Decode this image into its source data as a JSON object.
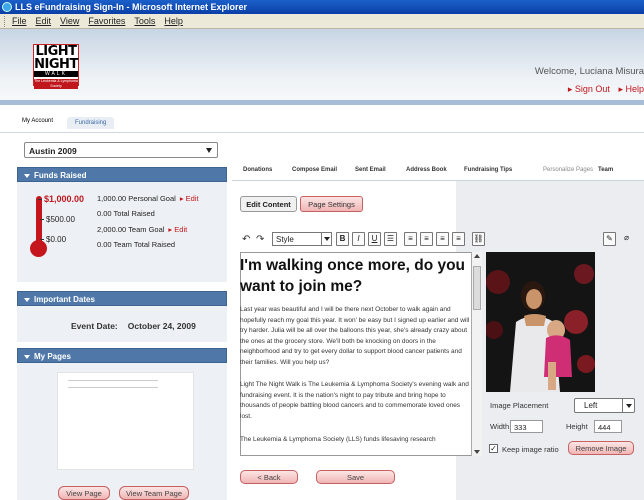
{
  "window": {
    "title": "LLS eFundraising Sign-In - Microsoft Internet Explorer"
  },
  "menu": {
    "items": [
      "File",
      "Edit",
      "View",
      "Favorites",
      "Tools",
      "Help"
    ]
  },
  "header": {
    "logo_top": "LIGHT",
    "logo_night": "NIGHT",
    "logo_walk": "WALK",
    "logo_society": "The Leukemia & Lymphoma Society",
    "welcome": "Welcome, Luciana Misura",
    "sign_out": "Sign Out",
    "help": "Help",
    "link_color": "#c0171d"
  },
  "account_nav": {
    "my_account": "My Account",
    "fundraising": "Fundraising"
  },
  "sidebar": {
    "campaign": "Austin 2009",
    "funds": {
      "title": "Funds Raised",
      "top_label": "$1,000.00",
      "mid_label": "$500.00",
      "low_label": "$0.00",
      "progress": 0.0,
      "rows": [
        {
          "text": "1,000.00 Personal Goal",
          "edit": "Edit"
        },
        {
          "text": "0.00 Total Raised",
          "edit": ""
        },
        {
          "text": "2,000.00 Team Goal",
          "edit": "Edit"
        },
        {
          "text": "0.00 Team Total Raised",
          "edit": ""
        }
      ]
    },
    "dates": {
      "title": "Important Dates",
      "label": "Event Date:",
      "value": "October 24, 2009"
    },
    "pages": {
      "title": "My Pages",
      "view_page": "View Page",
      "view_team_page": "View Team Page"
    }
  },
  "tabs": [
    "Donations",
    "Compose Email",
    "Sent Email",
    "Address Book",
    "Fundraising Tips",
    "Personalize Pages",
    "Team"
  ],
  "editor": {
    "sub_tabs": {
      "edit_content": "Edit Content",
      "page_settings": "Page Settings"
    },
    "style_label": "Style",
    "heading": "I'm walking once more, do you want to join me?",
    "paragraphs": [
      "Last year was beautiful and I will be there next October to walk again and hopefully reach my goal this year. It won' be easy but I signed up earlier and will try harder. Julia will be all over the balloons this year, she's already crazy about the ones at the grocery store. We'll both be knocking on doors in the neighborhood and try to get every dollar to support blood cancer patients and their families. Will you help us?",
      "Light The Night Walk is The Leukemia & Lymphoma Society's evening walk and fundraising event. It is the nation's night to pay tribute and bring hope to thousands of people battling blood cancers and to commemorate loved ones lost.",
      "The Leukemia & Lymphoma Society (LLS) funds lifesaving research"
    ]
  },
  "image_panel": {
    "placement_label": "Image Placement",
    "placement_value": "Left",
    "width_label": "Width",
    "width_value": "333",
    "height_label": "Height",
    "height_value": "444",
    "keep_ratio_label": "Keep image ratio",
    "keep_ratio_checked": true,
    "remove_label": "Remove Image"
  },
  "footer_buttons": {
    "back": "< Back",
    "save": "Save"
  }
}
